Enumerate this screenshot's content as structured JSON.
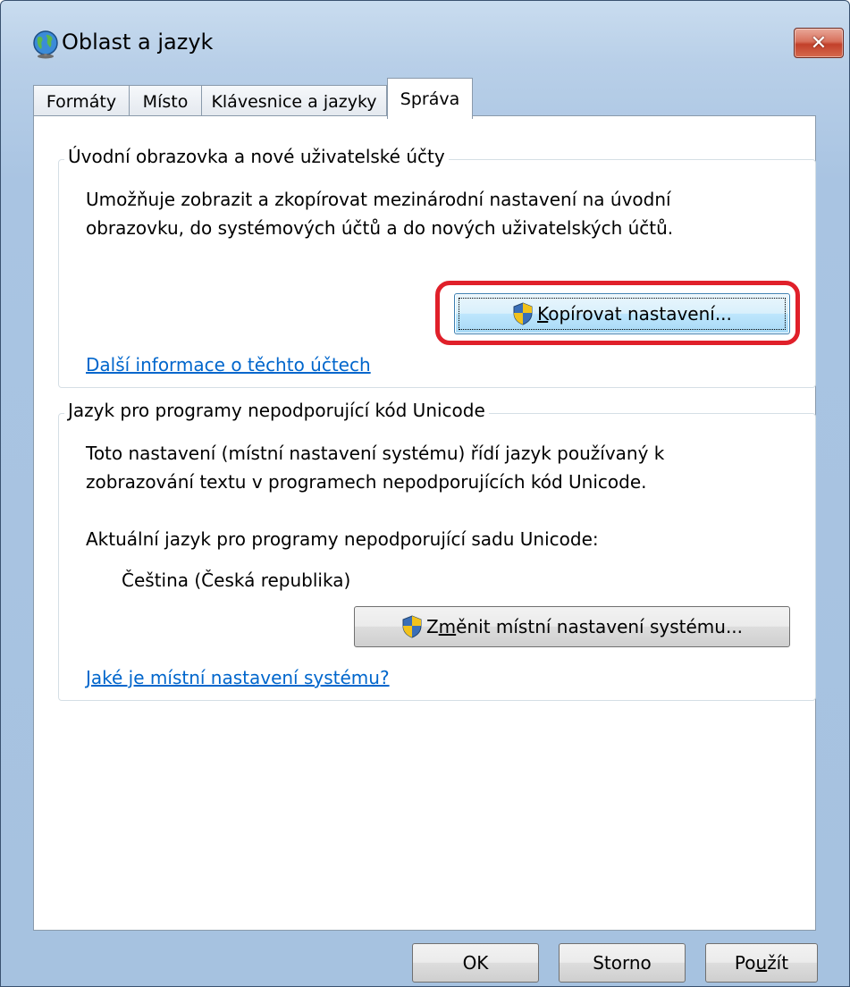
{
  "window": {
    "title": "Oblast a jazyk",
    "close_glyph": "✕"
  },
  "tabs": [
    {
      "label": "Formáty",
      "active": false
    },
    {
      "label": "Místo",
      "active": false
    },
    {
      "label": "Klávesnice a jazyky",
      "active": false
    },
    {
      "label": "Správa",
      "active": true
    }
  ],
  "welcome_group": {
    "legend": "Úvodní obrazovka a nové uživatelské účty",
    "description_line1": "Umožňuje zobrazit a zkopírovat mezinárodní nastavení na úvodní",
    "description_line2": "obrazovku, do systémových účtů a do nových uživatelských účtů.",
    "copy_button_prefix": "",
    "copy_button_underlined": "K",
    "copy_button_suffix": "opírovat nastavení...",
    "link": "Další informace o těchto účtech"
  },
  "unicode_group": {
    "legend": "Jazyk pro programy nepodporující kód Unicode",
    "description_line1": "Toto nastavení (místní nastavení systému) řídí jazyk používaný k",
    "description_line2": "zobrazování textu v programech nepodporujících kód Unicode.",
    "current_label": "Aktuální jazyk pro programy nepodporující sadu Unicode:",
    "current_value": "Čeština (Česká republika)",
    "change_button_prefix": "Z",
    "change_button_underlined": "m",
    "change_button_suffix": "ěnit místní nastavení systému...",
    "link": "Jaké je místní nastavení systému?"
  },
  "footer": {
    "ok": "OK",
    "cancel": "Storno",
    "apply_prefix": "Po",
    "apply_underlined": "u",
    "apply_suffix": "žít"
  },
  "colors": {
    "link": "#0066cc",
    "highlight": "#e0202a",
    "close_button": "#c2402a"
  },
  "icons": [
    "globe-icon",
    "uac-shield-icon",
    "close-icon"
  ]
}
